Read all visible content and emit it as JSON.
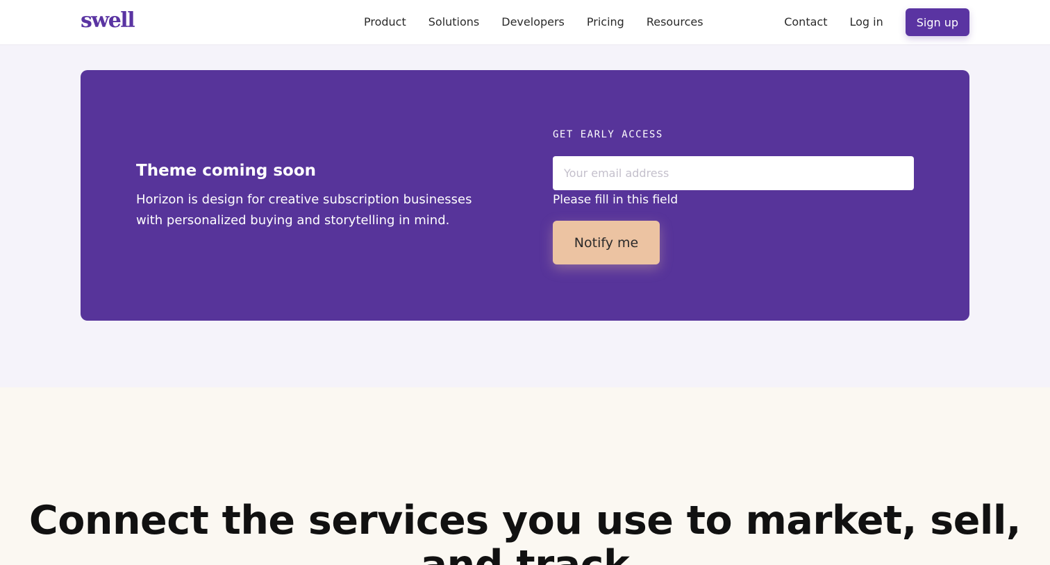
{
  "header": {
    "logo": "swell",
    "nav": [
      {
        "label": "Product"
      },
      {
        "label": "Solutions"
      },
      {
        "label": "Developers"
      },
      {
        "label": "Pricing"
      },
      {
        "label": "Resources"
      }
    ],
    "contact_label": "Contact",
    "login_label": "Log in",
    "signup_label": "Sign up"
  },
  "promo": {
    "title": "Theme coming soon",
    "description": "Horizon is design for creative subscription businesses with personalized buying and storytelling in mind.",
    "eyebrow": "GET EARLY ACCESS",
    "email_placeholder": "Your email address",
    "email_value": "",
    "error_text": "Please fill in this field",
    "notify_label": "Notify me"
  },
  "connect": {
    "heading": "Connect the services you use to market, sell, and track"
  },
  "colors": {
    "brand_purple": "#5a34a2",
    "card_purple": "#57349a",
    "notify_peach": "#ecc3a2",
    "page_lavender": "#f5f3fa",
    "section_cream": "#fbf8f2"
  }
}
